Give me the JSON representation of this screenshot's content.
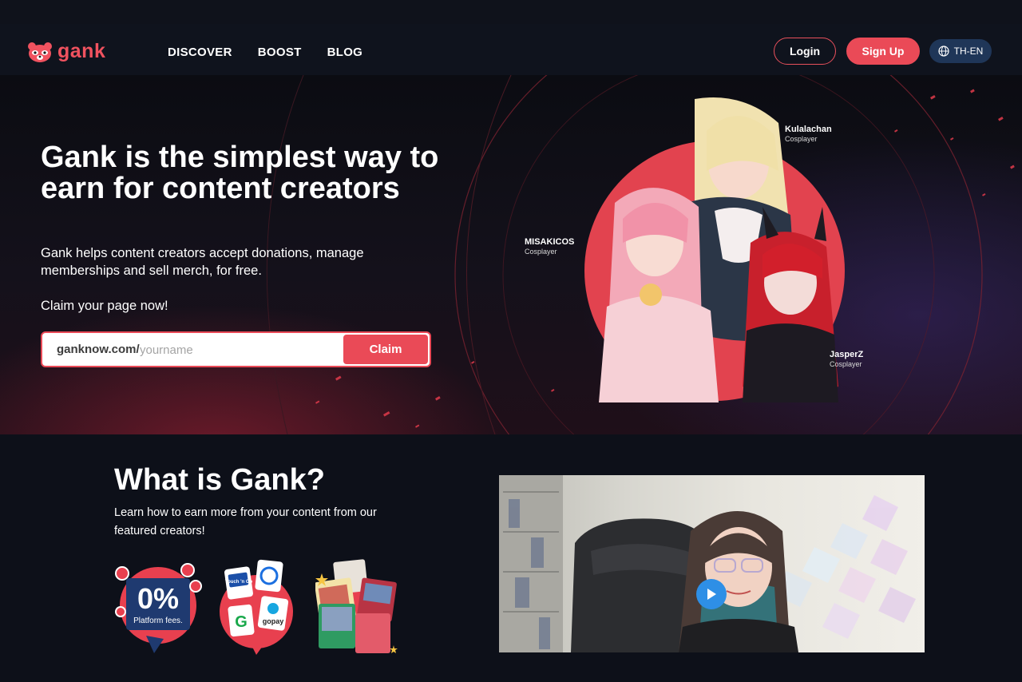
{
  "nav": {
    "logo_text": "gank",
    "links": [
      {
        "label": "DISCOVER"
      },
      {
        "label": "BOOST"
      },
      {
        "label": "BLOG"
      }
    ],
    "login_label": "Login",
    "signup_label": "Sign Up",
    "language_label": "TH-EN"
  },
  "hero": {
    "title": "Gank is the simplest way to earn for content creators",
    "subtitle": "Gank helps content creators accept donations, manage memberships and sell merch, for free.",
    "claim_prompt": "Claim your page now!",
    "claim_prefix": "ganknow.com/",
    "claim_placeholder": "yourname",
    "claim_button": "Claim",
    "creators": [
      {
        "name": "Kulalachan",
        "role": "Cosplayer"
      },
      {
        "name": "MISAKICOS",
        "role": "Cosplayer"
      },
      {
        "name": "JasperZ",
        "role": "Cosplayer"
      }
    ]
  },
  "what": {
    "title": "What is Gank?",
    "subtitle": "Learn how to earn more from your content from our featured creators!",
    "features": {
      "fees_big": "0%",
      "fees_small": "Platform fees.",
      "payments": [
        "Touch 'n Go",
        "G",
        "gopay"
      ]
    }
  },
  "colors": {
    "accent": "#ea4a57",
    "background": "#0d1019",
    "lang_bg": "#1f3658",
    "play": "#2e8fe6"
  }
}
